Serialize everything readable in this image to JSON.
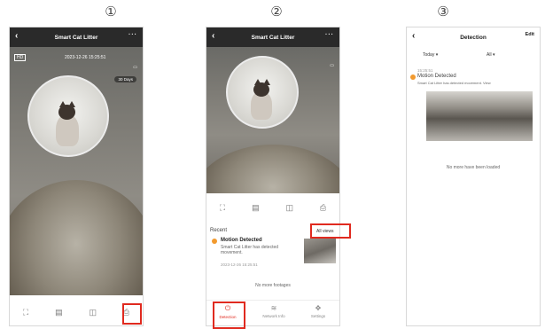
{
  "steps": [
    "①",
    "②",
    "③"
  ],
  "screen1": {
    "title": "Smart Cat Litter",
    "back_glyph": "‹",
    "more_glyph": "···",
    "tag": "HD",
    "timestamp": "2023-12-26  15:25:51",
    "battery_icon": "battery-icon",
    "stream_pill": "30 Days",
    "controls": [
      "fullscreen-icon",
      "album-icon",
      "record-icon",
      "events-icon"
    ]
  },
  "screen2": {
    "title": "Smart Cat Litter",
    "back_glyph": "‹",
    "more_glyph": "···",
    "controls": [
      "fullscreen-icon",
      "album-icon",
      "record-icon",
      "events-icon"
    ],
    "recent_label": "Recent",
    "all_views_label": "All views",
    "event": {
      "title": "Motion Detected",
      "description": "Smart Cat Litter has detected movement.",
      "time": "2023-12-26  15:25:51"
    },
    "no_more_label": "No more footages",
    "nav": [
      {
        "icon": "alert-icon",
        "label": "Detection"
      },
      {
        "icon": "wifi-icon",
        "label": "Network Info"
      },
      {
        "icon": "settings-icon",
        "label": "Settings"
      }
    ]
  },
  "screen3": {
    "title": "Detection",
    "back_glyph": "‹",
    "edit_label": "Edit",
    "filter_left": "Today ▾",
    "filter_right": "All ▾",
    "event_time": "15:25:51",
    "event_title": "Motion Detected",
    "event_desc": "Smart Cat Litter has detected movement. View",
    "no_more_label": "No more have been loaded"
  },
  "colors": {
    "accent": "#e02a1f",
    "event_dot": "#f29a2e",
    "header_dark": "#2a2a2a"
  }
}
